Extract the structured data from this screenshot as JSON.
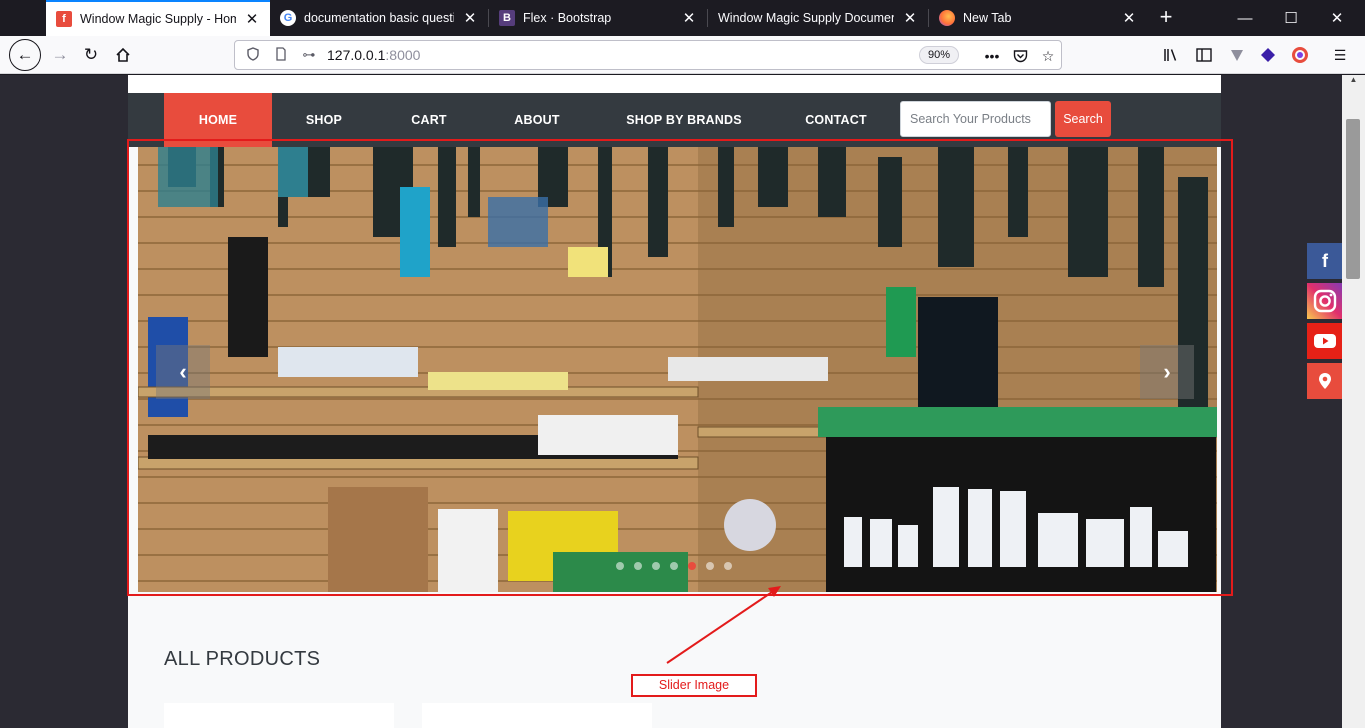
{
  "browser": {
    "tabs": [
      {
        "title": "Window Magic Supply - Home",
        "favicon": "f",
        "favicon_color": "#e84c3d",
        "active": true
      },
      {
        "title": "documentation basic question",
        "favicon": "G",
        "favicon_color": "#4285f4",
        "active": false
      },
      {
        "title": "Flex · Bootstrap",
        "favicon": "B",
        "favicon_color": "#563d7c",
        "active": false
      },
      {
        "title": "Window Magic Supply Documentation",
        "favicon": "",
        "favicon_color": "",
        "active": false
      },
      {
        "title": "New Tab",
        "favicon": "firefox-icon",
        "favicon_color": "#ff7139",
        "active": false
      }
    ],
    "url_host": "127.0.0.1",
    "url_port": ":8000",
    "zoom": "90%"
  },
  "site": {
    "menu": [
      "HOME",
      "SHOP",
      "CART",
      "ABOUT",
      "SHOP BY BRANDS",
      "CONTACT"
    ],
    "active_menu": "HOME",
    "search_placeholder": "Search Your Products",
    "search_button": "Search",
    "slider": {
      "slide_count": 7,
      "active_index": 4
    },
    "section_heading": "ALL PRODUCTS",
    "social": [
      {
        "name": "facebook-icon",
        "color": "#3b5998"
      },
      {
        "name": "instagram-icon",
        "color": "#c13584"
      },
      {
        "name": "youtube-icon",
        "color": "#e62117"
      },
      {
        "name": "location-pin-icon",
        "color": "#e84c3d"
      }
    ]
  },
  "annotation": {
    "label": "Slider Image",
    "color": "#e31b1b"
  },
  "colors": {
    "accent": "#e84c3d",
    "nav_bg": "#343a40"
  }
}
